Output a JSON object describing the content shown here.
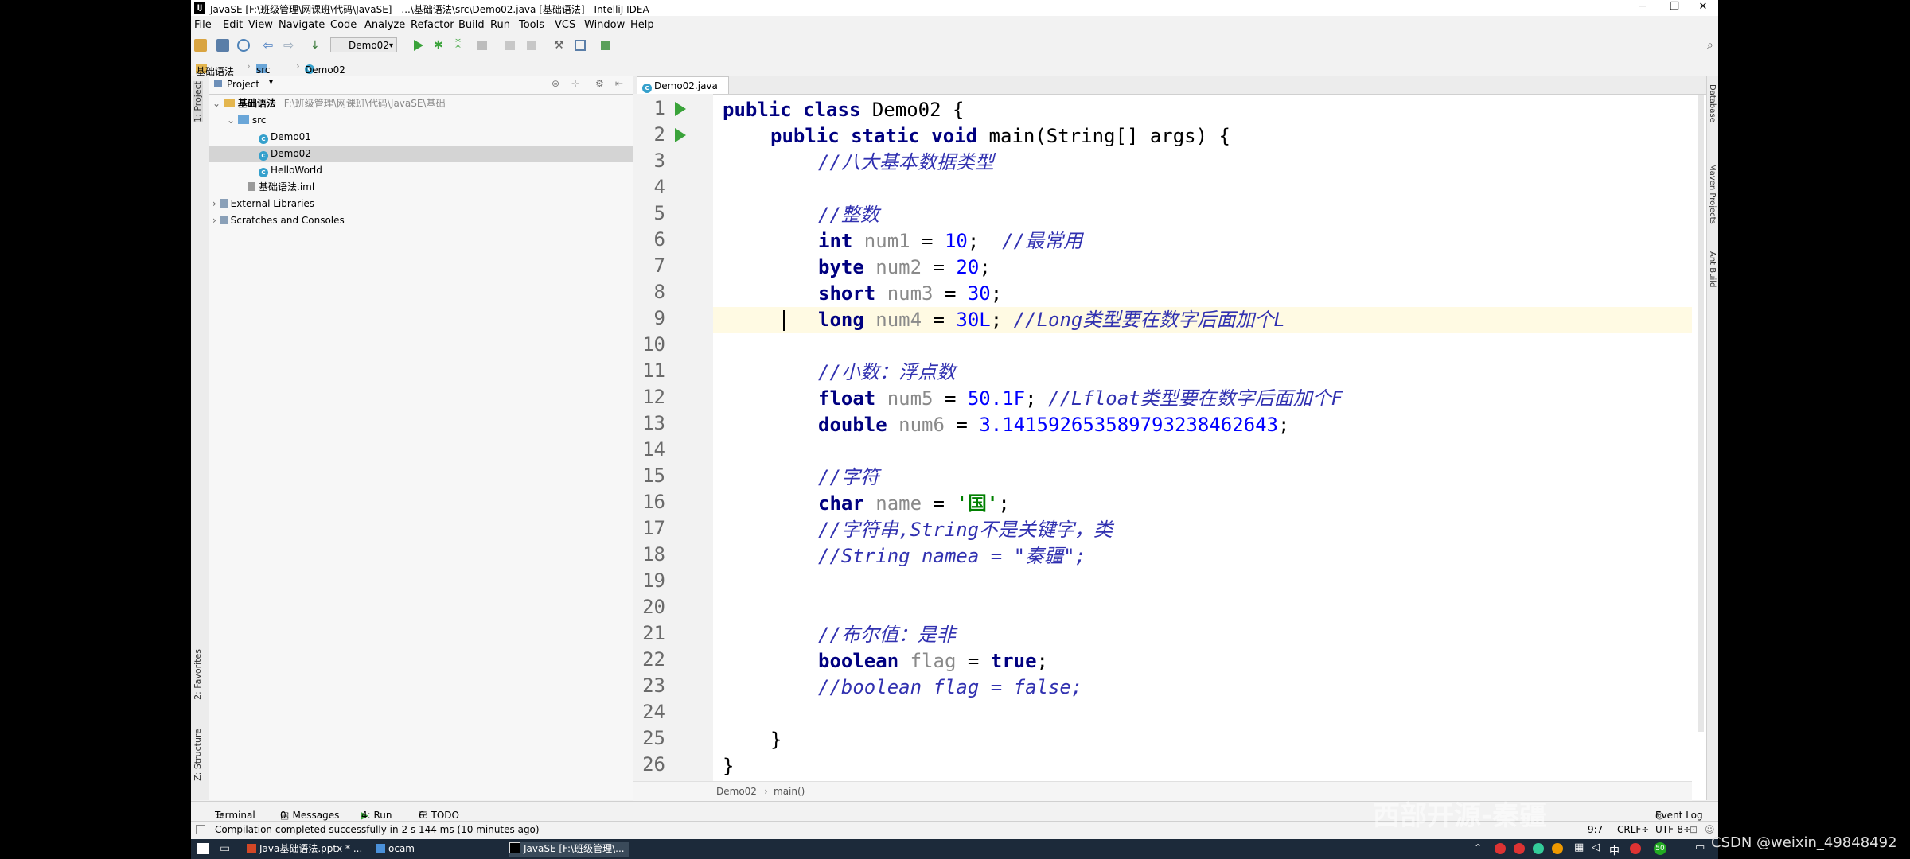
{
  "titlebar": {
    "text": "JavaSE [F:\\班级管理\\网课班\\代码\\JavaSE] - ...\\基础语法\\src\\Demo02.java [基础语法] - IntelliJ IDEA",
    "min": "─",
    "max": "❐",
    "close": "✕"
  },
  "menu": [
    "File",
    "Edit",
    "View",
    "Navigate",
    "Code",
    "Analyze",
    "Refactor",
    "Build",
    "Run",
    "Tools",
    "VCS",
    "Window",
    "Help"
  ],
  "toolbar": {
    "run_config": "Demo02"
  },
  "navbar": {
    "items": [
      "基础语法",
      "src",
      "Demo02"
    ]
  },
  "left_stripe": {
    "project": "1: Project",
    "favorites": "2: Favorites",
    "structure": "Z: Structure"
  },
  "project": {
    "header": "Project",
    "root": {
      "name": "基础语法",
      "path": "F:\\班级管理\\网课班\\代码\\JavaSE\\基础"
    },
    "src": "src",
    "files": [
      "Demo01",
      "Demo02",
      "HelloWorld"
    ],
    "iml": "基础语法.iml",
    "external": "External Libraries",
    "scratches": "Scratches and Consoles"
  },
  "editor": {
    "tab": "Demo02.java",
    "line_numbers": [
      "1",
      "2",
      "3",
      "4",
      "5",
      "6",
      "7",
      "8",
      "9",
      "10",
      "11",
      "12",
      "13",
      "14",
      "15",
      "16",
      "17",
      "18",
      "19",
      "20",
      "21",
      "22",
      "23",
      "24",
      "25",
      "26"
    ],
    "code": {
      "l1": {
        "kw": "public class ",
        "rest": "Demo02 {"
      },
      "l2": {
        "kw": "public static void ",
        "rest": "main(String[] args) {"
      },
      "l3": "//八大基本数据类型",
      "l5": "//整数",
      "l6": {
        "kw": "int ",
        "var": "num1",
        "op": " = ",
        "num": "10",
        "end": ";  ",
        "cm": "//最常用"
      },
      "l7": {
        "kw": "byte ",
        "var": "num2",
        "op": " = ",
        "num": "20",
        "end": ";"
      },
      "l8": {
        "kw": "short ",
        "var": "num3",
        "op": " = ",
        "num": "30",
        "end": ";"
      },
      "l9": {
        "kw": "long ",
        "var": "num4",
        "op": " = ",
        "num": "30L",
        "end": "; ",
        "cm": "//Long类型要在数字后面加个L"
      },
      "l11": "//小数：浮点数",
      "l12": {
        "kw": "float ",
        "var": "num5",
        "op": " = ",
        "num": "50.1F",
        "end": "; ",
        "cm": "//Lfloat类型要在数字后面加个F"
      },
      "l13": {
        "kw": "double ",
        "var": "num6",
        "op": " = ",
        "num": "3.141592653589793238462643",
        "end": ";"
      },
      "l15": "//字符",
      "l16": {
        "kw": "char ",
        "var": "name",
        "op": " = ",
        "str": "'国'",
        "end": ";"
      },
      "l17": "//字符串,String不是关键字，类",
      "l18": "//String namea = \"秦疆\";",
      "l21": "//布尔值：是非",
      "l22": {
        "kw": "boolean ",
        "var": "flag",
        "op": " = ",
        "val": "true",
        "end": ";"
      },
      "l23": "//boolean flag = false;",
      "l25": "}",
      "l26": "}"
    },
    "breadcrumb": [
      "Demo02",
      "main()"
    ]
  },
  "right_stripe": [
    "Database",
    "Maven Projects",
    "Ant Build"
  ],
  "toolwindows": [
    "Terminal",
    "0: Messages",
    "4: Run",
    "6: TODO",
    "Event Log"
  ],
  "status": {
    "message": "Compilation completed successfully in 2 s 144 ms (10 minutes ago)",
    "pos": "9:7",
    "crlf": "CRLF÷",
    "enc": "UTF-8÷"
  },
  "taskbar": {
    "items": [
      "Java基础语法.pptx * ...",
      "ocam",
      "JavaSE [F:\\班级管理\\..."
    ],
    "ime": "中"
  },
  "overlay": {
    "csdn": "CSDN @weixin_49848492",
    "watermark": "西部开源-秦疆"
  }
}
